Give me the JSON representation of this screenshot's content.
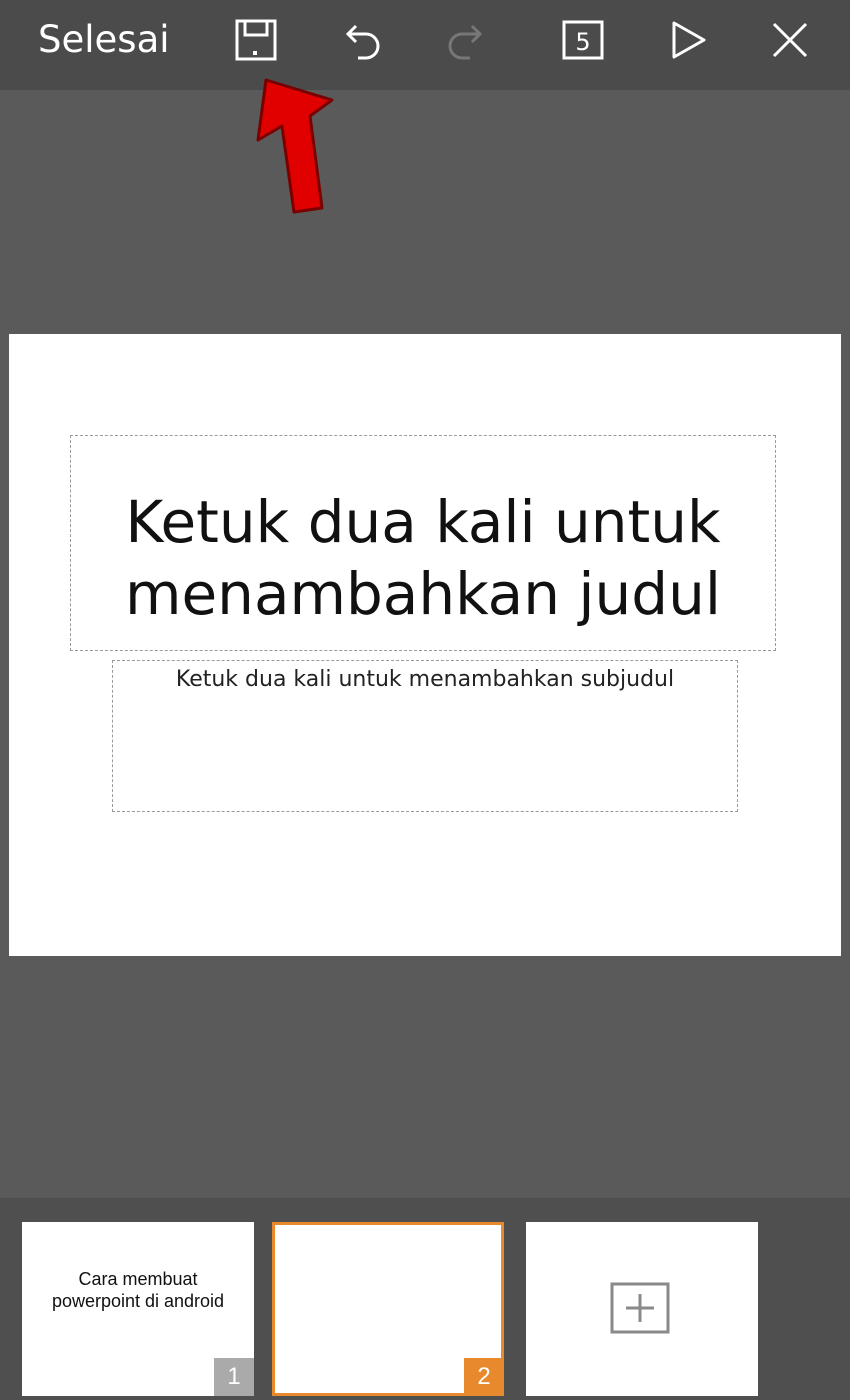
{
  "toolbar": {
    "done_label": "Selesai",
    "icons": [
      "save-icon",
      "undo-icon",
      "redo-icon",
      "slide-count-icon",
      "play-icon",
      "close-icon"
    ],
    "slide_count": "5"
  },
  "slide": {
    "title_placeholder": "Ketuk dua kali untuk menambahkan judul",
    "subtitle_placeholder": "Ketuk dua kali untuk menambahkan subjudul"
  },
  "thumbnails": [
    {
      "title": "Cara membuat powerpoint di android",
      "number": "1",
      "selected": false
    },
    {
      "title": "",
      "number": "2",
      "selected": true
    }
  ],
  "add_slide": {
    "icon": "plus-icon"
  },
  "colors": {
    "toolbar_bg": "#4b4b4b",
    "canvas_bg": "#5a5a5a",
    "selected_accent": "#e8892d",
    "annotation_arrow": "#e00000"
  }
}
